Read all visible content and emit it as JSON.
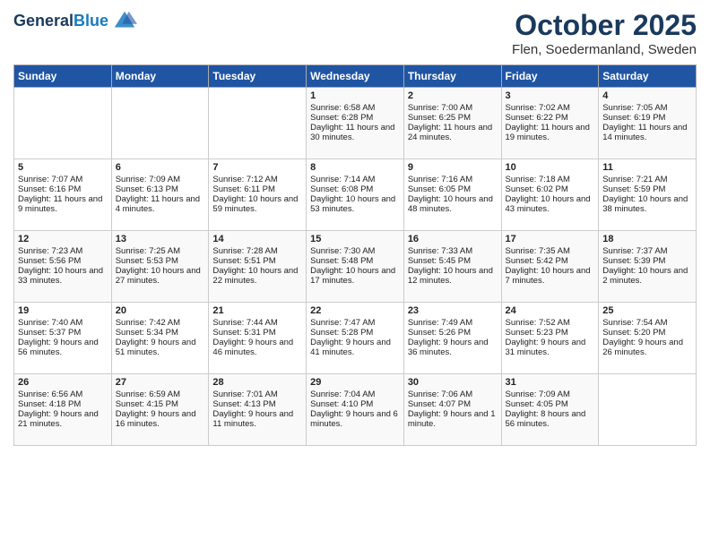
{
  "header": {
    "logo_line1": "General",
    "logo_line2": "Blue",
    "title": "October 2025",
    "subtitle": "Flen, Soedermanland, Sweden"
  },
  "weekdays": [
    "Sunday",
    "Monday",
    "Tuesday",
    "Wednesday",
    "Thursday",
    "Friday",
    "Saturday"
  ],
  "weeks": [
    [
      {
        "day": "",
        "sunrise": "",
        "sunset": "",
        "daylight": ""
      },
      {
        "day": "",
        "sunrise": "",
        "sunset": "",
        "daylight": ""
      },
      {
        "day": "",
        "sunrise": "",
        "sunset": "",
        "daylight": ""
      },
      {
        "day": "1",
        "sunrise": "Sunrise: 6:58 AM",
        "sunset": "Sunset: 6:28 PM",
        "daylight": "Daylight: 11 hours and 30 minutes."
      },
      {
        "day": "2",
        "sunrise": "Sunrise: 7:00 AM",
        "sunset": "Sunset: 6:25 PM",
        "daylight": "Daylight: 11 hours and 24 minutes."
      },
      {
        "day": "3",
        "sunrise": "Sunrise: 7:02 AM",
        "sunset": "Sunset: 6:22 PM",
        "daylight": "Daylight: 11 hours and 19 minutes."
      },
      {
        "day": "4",
        "sunrise": "Sunrise: 7:05 AM",
        "sunset": "Sunset: 6:19 PM",
        "daylight": "Daylight: 11 hours and 14 minutes."
      }
    ],
    [
      {
        "day": "5",
        "sunrise": "Sunrise: 7:07 AM",
        "sunset": "Sunset: 6:16 PM",
        "daylight": "Daylight: 11 hours and 9 minutes."
      },
      {
        "day": "6",
        "sunrise": "Sunrise: 7:09 AM",
        "sunset": "Sunset: 6:13 PM",
        "daylight": "Daylight: 11 hours and 4 minutes."
      },
      {
        "day": "7",
        "sunrise": "Sunrise: 7:12 AM",
        "sunset": "Sunset: 6:11 PM",
        "daylight": "Daylight: 10 hours and 59 minutes."
      },
      {
        "day": "8",
        "sunrise": "Sunrise: 7:14 AM",
        "sunset": "Sunset: 6:08 PM",
        "daylight": "Daylight: 10 hours and 53 minutes."
      },
      {
        "day": "9",
        "sunrise": "Sunrise: 7:16 AM",
        "sunset": "Sunset: 6:05 PM",
        "daylight": "Daylight: 10 hours and 48 minutes."
      },
      {
        "day": "10",
        "sunrise": "Sunrise: 7:18 AM",
        "sunset": "Sunset: 6:02 PM",
        "daylight": "Daylight: 10 hours and 43 minutes."
      },
      {
        "day": "11",
        "sunrise": "Sunrise: 7:21 AM",
        "sunset": "Sunset: 5:59 PM",
        "daylight": "Daylight: 10 hours and 38 minutes."
      }
    ],
    [
      {
        "day": "12",
        "sunrise": "Sunrise: 7:23 AM",
        "sunset": "Sunset: 5:56 PM",
        "daylight": "Daylight: 10 hours and 33 minutes."
      },
      {
        "day": "13",
        "sunrise": "Sunrise: 7:25 AM",
        "sunset": "Sunset: 5:53 PM",
        "daylight": "Daylight: 10 hours and 27 minutes."
      },
      {
        "day": "14",
        "sunrise": "Sunrise: 7:28 AM",
        "sunset": "Sunset: 5:51 PM",
        "daylight": "Daylight: 10 hours and 22 minutes."
      },
      {
        "day": "15",
        "sunrise": "Sunrise: 7:30 AM",
        "sunset": "Sunset: 5:48 PM",
        "daylight": "Daylight: 10 hours and 17 minutes."
      },
      {
        "day": "16",
        "sunrise": "Sunrise: 7:33 AM",
        "sunset": "Sunset: 5:45 PM",
        "daylight": "Daylight: 10 hours and 12 minutes."
      },
      {
        "day": "17",
        "sunrise": "Sunrise: 7:35 AM",
        "sunset": "Sunset: 5:42 PM",
        "daylight": "Daylight: 10 hours and 7 minutes."
      },
      {
        "day": "18",
        "sunrise": "Sunrise: 7:37 AM",
        "sunset": "Sunset: 5:39 PM",
        "daylight": "Daylight: 10 hours and 2 minutes."
      }
    ],
    [
      {
        "day": "19",
        "sunrise": "Sunrise: 7:40 AM",
        "sunset": "Sunset: 5:37 PM",
        "daylight": "Daylight: 9 hours and 56 minutes."
      },
      {
        "day": "20",
        "sunrise": "Sunrise: 7:42 AM",
        "sunset": "Sunset: 5:34 PM",
        "daylight": "Daylight: 9 hours and 51 minutes."
      },
      {
        "day": "21",
        "sunrise": "Sunrise: 7:44 AM",
        "sunset": "Sunset: 5:31 PM",
        "daylight": "Daylight: 9 hours and 46 minutes."
      },
      {
        "day": "22",
        "sunrise": "Sunrise: 7:47 AM",
        "sunset": "Sunset: 5:28 PM",
        "daylight": "Daylight: 9 hours and 41 minutes."
      },
      {
        "day": "23",
        "sunrise": "Sunrise: 7:49 AM",
        "sunset": "Sunset: 5:26 PM",
        "daylight": "Daylight: 9 hours and 36 minutes."
      },
      {
        "day": "24",
        "sunrise": "Sunrise: 7:52 AM",
        "sunset": "Sunset: 5:23 PM",
        "daylight": "Daylight: 9 hours and 31 minutes."
      },
      {
        "day": "25",
        "sunrise": "Sunrise: 7:54 AM",
        "sunset": "Sunset: 5:20 PM",
        "daylight": "Daylight: 9 hours and 26 minutes."
      }
    ],
    [
      {
        "day": "26",
        "sunrise": "Sunrise: 6:56 AM",
        "sunset": "Sunset: 4:18 PM",
        "daylight": "Daylight: 9 hours and 21 minutes."
      },
      {
        "day": "27",
        "sunrise": "Sunrise: 6:59 AM",
        "sunset": "Sunset: 4:15 PM",
        "daylight": "Daylight: 9 hours and 16 minutes."
      },
      {
        "day": "28",
        "sunrise": "Sunrise: 7:01 AM",
        "sunset": "Sunset: 4:13 PM",
        "daylight": "Daylight: 9 hours and 11 minutes."
      },
      {
        "day": "29",
        "sunrise": "Sunrise: 7:04 AM",
        "sunset": "Sunset: 4:10 PM",
        "daylight": "Daylight: 9 hours and 6 minutes."
      },
      {
        "day": "30",
        "sunrise": "Sunrise: 7:06 AM",
        "sunset": "Sunset: 4:07 PM",
        "daylight": "Daylight: 9 hours and 1 minute."
      },
      {
        "day": "31",
        "sunrise": "Sunrise: 7:09 AM",
        "sunset": "Sunset: 4:05 PM",
        "daylight": "Daylight: 8 hours and 56 minutes."
      },
      {
        "day": "",
        "sunrise": "",
        "sunset": "",
        "daylight": ""
      }
    ]
  ]
}
